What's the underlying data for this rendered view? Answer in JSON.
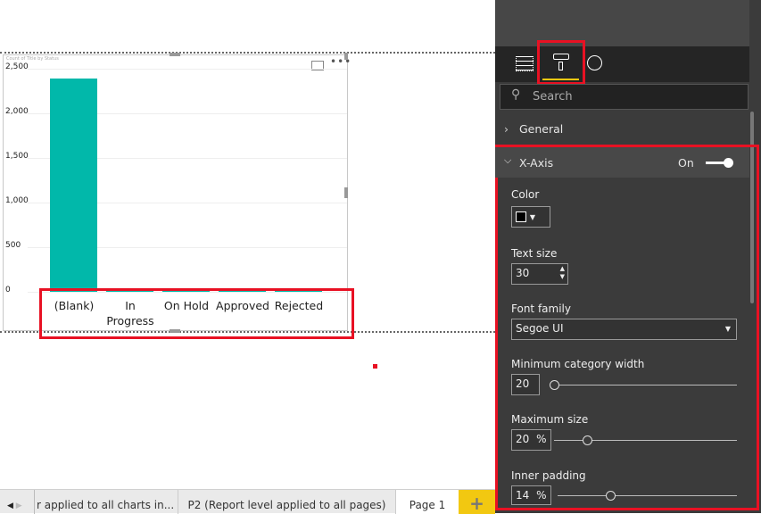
{
  "chart_data": {
    "type": "bar",
    "title": "Count of Title by Status",
    "categories": [
      "(Blank)",
      "In Progress",
      "On Hold",
      "Approved",
      "Rejected"
    ],
    "values": [
      2390,
      12,
      10,
      8,
      6
    ],
    "yticks": [
      "2,500",
      "2,000",
      "1,500",
      "1,000",
      "500",
      "0"
    ],
    "ylim": [
      0,
      2500
    ],
    "color": "#01b8aa"
  },
  "page_tabs": [
    "r applied to all charts in...",
    "P2 (Report level applied to all pages)",
    "Page 1"
  ],
  "add_page": "+",
  "panel": {
    "search_placeholder": "Search",
    "general": "General",
    "xaxis": {
      "title": "X-Axis",
      "toggle": "On"
    },
    "color_label": "Color",
    "text_size_label": "Text size",
    "text_size": "30",
    "font_family_label": "Font family",
    "font_family": "Segoe UI",
    "min_cat_label": "Minimum category width",
    "min_cat": "20",
    "max_size_label": "Maximum size",
    "max_size": "20",
    "max_size_unit": "%",
    "inner_pad_label": "Inner padding",
    "inner_pad": "14",
    "inner_pad_unit": "%"
  },
  "accent": "#f2c811",
  "highlight": "#e81123"
}
